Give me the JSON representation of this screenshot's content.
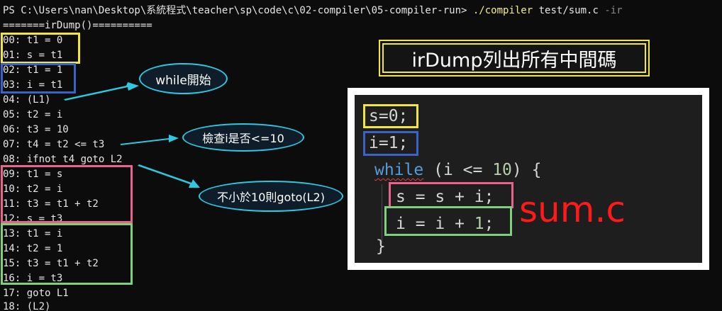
{
  "terminal": {
    "prompt": "PS C:\\Users\\nan\\Desktop\\系統程式\\teacher\\sp\\code\\c\\02-compiler\\05-compiler-run> ",
    "command": "./compiler",
    "argument": " test/sum.c",
    "flag": " -ir",
    "header": "=======irDump()==========",
    "lines": [
      "00: t1 = 0",
      "01: s = t1",
      "02: t1 = 1",
      "03: i = t1",
      "04: (L1)",
      "05: t2 = i",
      "06: t3 = 10",
      "07: t4 = t2 <= t3",
      "08: ifnot t4 goto L2",
      "09: t1 = s",
      "10: t2 = i",
      "11: t3 = t1 + t2",
      "12: s = t3",
      "13: t1 = i",
      "14: t2 = 1",
      "15: t3 = t1 + t2",
      "16: i = t3",
      "17: goto L1",
      "18: (L2)"
    ]
  },
  "callouts": {
    "while_start": "while開始",
    "check_le10": "檢查i是否<=10",
    "goto_l2": "不小於10則goto(L2)"
  },
  "title": "irDump列出所有中間碼",
  "code": {
    "line1": "s=0;",
    "line2": "i=1;",
    "while_kw": "while",
    "cond_open": " (i <= ",
    "cond_num": "10",
    "cond_close": ") {",
    "body1": "s = s + i;",
    "body2_a": "i = i + ",
    "body2_num": "1",
    "body2_b": ";",
    "close": "}"
  },
  "filename": "sum.c",
  "colors": {
    "yellow": "#f2e63a",
    "blue": "#3a63c9",
    "pink": "#e8648c",
    "green": "#7ed07e",
    "cyan": "#2ec9e0",
    "red": "#ff1a1a"
  }
}
